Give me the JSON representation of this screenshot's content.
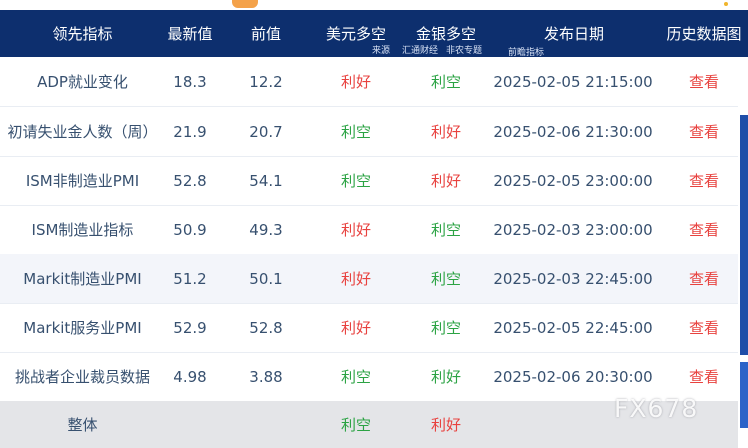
{
  "header": {
    "columns": [
      "领先指标",
      "最新值",
      "前值",
      "美元多空",
      "金银多空",
      "发布日期",
      "历史数据图"
    ],
    "source_label": "来源",
    "source_huitong": "汇通财经",
    "source_feinong": "非农专题",
    "source_qianzhan": "前瞻指标"
  },
  "rows": [
    {
      "name": "ADP就业变化",
      "latest": "18.3",
      "prev": "12.2",
      "usd": "利好",
      "gold": "利空",
      "date": "2025-02-05 21:15:00",
      "action": "查看"
    },
    {
      "name": "初请失业金人数（周）",
      "latest": "21.9",
      "prev": "20.7",
      "usd": "利空",
      "gold": "利好",
      "date": "2025-02-06 21:30:00",
      "action": "查看"
    },
    {
      "name": "ISM非制造业PMI",
      "latest": "52.8",
      "prev": "54.1",
      "usd": "利空",
      "gold": "利好",
      "date": "2025-02-05 23:00:00",
      "action": "查看"
    },
    {
      "name": "ISM制造业指标",
      "latest": "50.9",
      "prev": "49.3",
      "usd": "利好",
      "gold": "利空",
      "date": "2025-02-03 23:00:00",
      "action": "查看"
    },
    {
      "name": "Markit制造业PMI",
      "latest": "51.2",
      "prev": "50.1",
      "usd": "利好",
      "gold": "利空",
      "date": "2025-02-03 22:45:00",
      "action": "查看"
    },
    {
      "name": "Markit服务业PMI",
      "latest": "52.9",
      "prev": "52.8",
      "usd": "利好",
      "gold": "利空",
      "date": "2025-02-05 22:45:00",
      "action": "查看"
    },
    {
      "name": "挑战者企业裁员数据",
      "latest": "4.98",
      "prev": "3.88",
      "usd": "利空",
      "gold": "利好",
      "date": "2025-02-06 20:30:00",
      "action": "查看"
    }
  ],
  "total": {
    "name": "整体",
    "usd": "利空",
    "gold": "利好"
  },
  "watermark": "FX678",
  "colors": {
    "header_bg": "#0d2f6e",
    "bullish": "#e8423f",
    "bearish": "#2ca344",
    "text": "#37506f"
  }
}
